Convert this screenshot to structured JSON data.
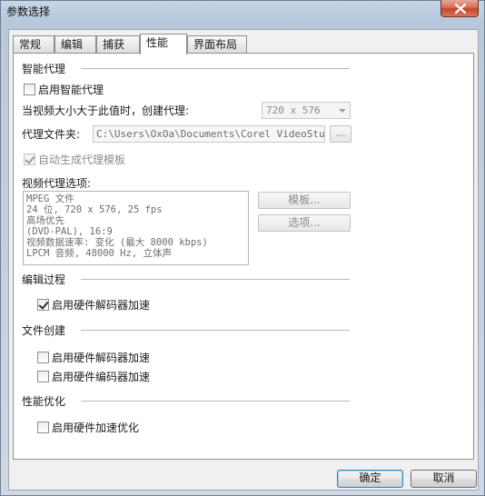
{
  "window": {
    "title": "参数选择"
  },
  "tabs": [
    {
      "label": "常规"
    },
    {
      "label": "编辑"
    },
    {
      "label": "捕获"
    },
    {
      "label": "性能"
    },
    {
      "label": "界面布局"
    }
  ],
  "active_tab": "性能",
  "smart_proxy": {
    "section_title": "智能代理",
    "enable_label": "启用智能代理",
    "enable_checked": false,
    "threshold_label": "当视频大小大于此值时，创建代理:",
    "threshold_value": "720 x 576",
    "folder_label": "代理文件夹:",
    "folder_value": "C:\\Users\\OxOa\\Documents\\Corel VideoStudio",
    "browse_label": "...",
    "auto_template_label": "自动生成代理模板",
    "auto_template_checked": true,
    "options_label": "视频代理选项:",
    "info_lines": [
      "MPEG 文件",
      "24 位, 720 x 576, 25 fps",
      "高场优先",
      "(DVD-PAL), 16:9",
      "视频数据速率: 变化 (最大 8000 kbps)",
      "LPCM 音频, 48000 Hz, 立体声"
    ],
    "template_button": "模板...",
    "options_button": "选项..."
  },
  "editing": {
    "section_title": "编辑过程",
    "hw_decoder_label": "启用硬件解码器加速",
    "hw_decoder_checked": true
  },
  "file_creation": {
    "section_title": "文件创建",
    "hw_decoder_label": "启用硬件解码器加速",
    "hw_decoder_checked": false,
    "hw_encoder_label": "启用硬件编码器加速",
    "hw_encoder_checked": false
  },
  "optimization": {
    "section_title": "性能优化",
    "hw_accel_label": "启用硬件加速优化",
    "hw_accel_checked": false
  },
  "footer": {
    "ok_label": "确定",
    "cancel_label": "取消"
  },
  "colors": {
    "title_bar": "#b7c8dc",
    "close_button": "#c6452b",
    "panel": "#ffffff"
  }
}
